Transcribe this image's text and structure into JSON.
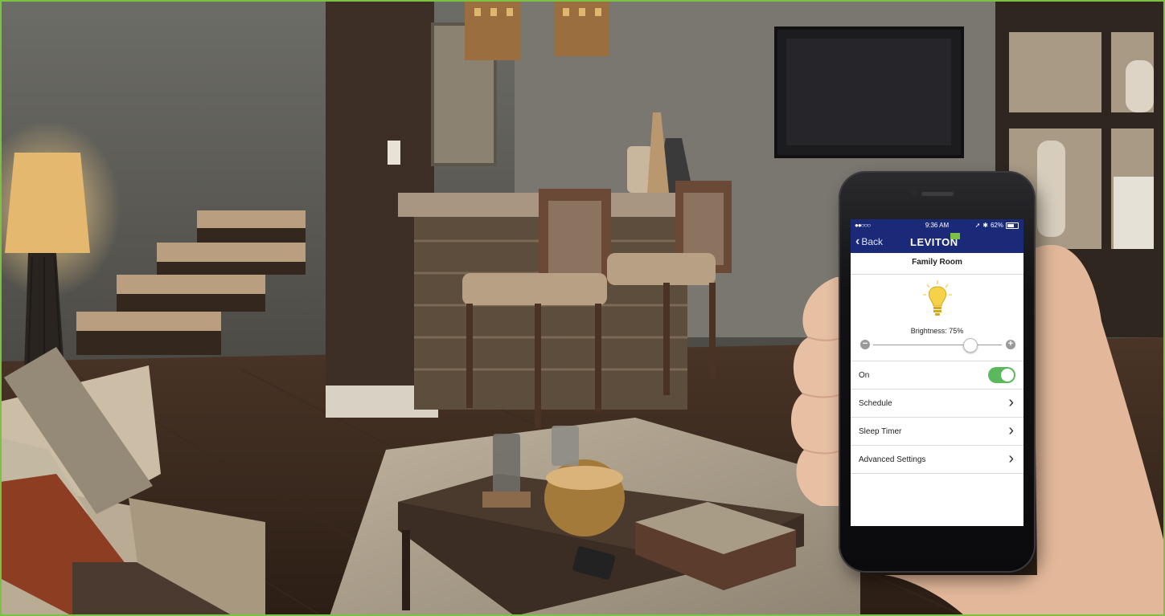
{
  "app": {
    "status_bar": {
      "signal": "●●○○○",
      "time": "9:36 AM",
      "battery": "62%"
    },
    "nav": {
      "back_label": "Back",
      "logo": "LEVITON"
    },
    "room_name": "Family Room",
    "brightness_label": "Brightness: 75%",
    "brightness_level": 0.75,
    "on_label": "On",
    "on_state": true,
    "menu_items": [
      {
        "label": "Schedule"
      },
      {
        "label": "Sleep Timer"
      },
      {
        "label": "Advanced Settings"
      }
    ],
    "colors": {
      "header": "#1b2a78",
      "toggle": "#5cb85c",
      "frame": "#7cc242"
    }
  }
}
